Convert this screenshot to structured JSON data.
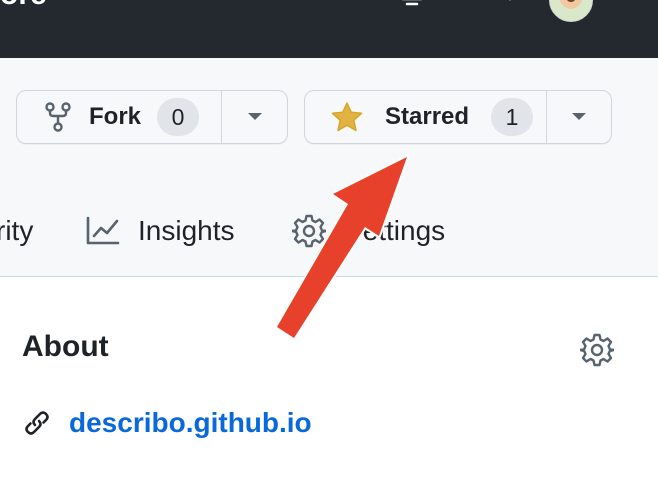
{
  "topbar": {
    "partial_title": "ore"
  },
  "repo_actions": {
    "fork": {
      "label": "Fork",
      "count": "0"
    },
    "star": {
      "label": "Starred",
      "count": "1"
    }
  },
  "tabs": [
    {
      "label": "rity"
    },
    {
      "label": "Insights"
    },
    {
      "label": "Settings"
    }
  ],
  "about": {
    "title": "About",
    "website": "describo.github.io"
  },
  "colors": {
    "topbar": "#24292f",
    "link": "#0969da",
    "star": "#e3b341",
    "annotation": "#e8412b"
  },
  "icons": {
    "fork": "repo-forked-icon",
    "star": "star-fill-icon",
    "insights": "graph-icon",
    "settings": "gear-icon",
    "link": "link-icon"
  }
}
